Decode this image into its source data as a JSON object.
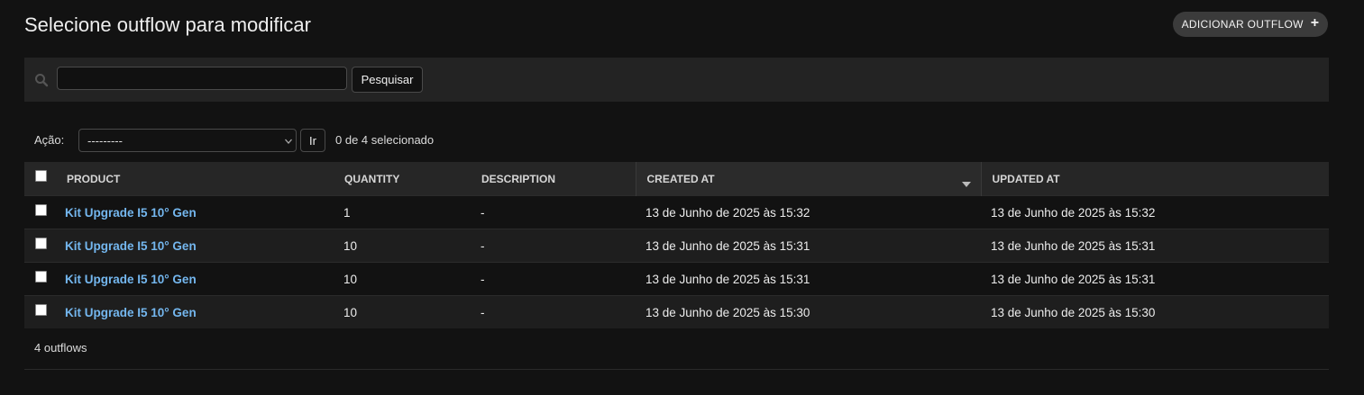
{
  "header": {
    "title": "Selecione outflow para modificar",
    "add_button_label": "ADICIONAR OUTFLOW"
  },
  "search": {
    "value": "",
    "button_label": "Pesquisar"
  },
  "actions": {
    "label": "Ação:",
    "selected": "---------",
    "go_label": "Ir",
    "counter": "0 de 4 selecionado"
  },
  "table": {
    "headers": {
      "product": "PRODUCT",
      "quantity": "QUANTITY",
      "description": "DESCRIPTION",
      "created_at": "CREATED AT",
      "updated_at": "UPDATED AT"
    },
    "sorted_column": "created_at",
    "sort_direction": "descending",
    "rows": [
      {
        "product": "Kit Upgrade I5 10° Gen",
        "quantity": "1",
        "description": "-",
        "created_at": "13 de Junho de 2025 às 15:32",
        "updated_at": "13 de Junho de 2025 às 15:32",
        "checked": false
      },
      {
        "product": "Kit Upgrade I5 10° Gen",
        "quantity": "10",
        "description": "-",
        "created_at": "13 de Junho de 2025 às 15:31",
        "updated_at": "13 de Junho de 2025 às 15:31",
        "checked": false
      },
      {
        "product": "Kit Upgrade I5 10° Gen",
        "quantity": "10",
        "description": "-",
        "created_at": "13 de Junho de 2025 às 15:31",
        "updated_at": "13 de Junho de 2025 às 15:31",
        "checked": false
      },
      {
        "product": "Kit Upgrade I5 10° Gen",
        "quantity": "10",
        "description": "-",
        "created_at": "13 de Junho de 2025 às 15:30",
        "updated_at": "13 de Junho de 2025 às 15:30",
        "checked": false
      }
    ]
  },
  "footer": {
    "count_text": "4 outflows"
  },
  "colors": {
    "background": "#121212",
    "toolbar": "#232323",
    "link": "#74b7ef",
    "button": "#3b3b3b"
  },
  "icons": {
    "search": "search-icon",
    "add": "plus-icon",
    "select_chevron": "chevron-down-icon",
    "sort": "sort-descending-icon"
  }
}
